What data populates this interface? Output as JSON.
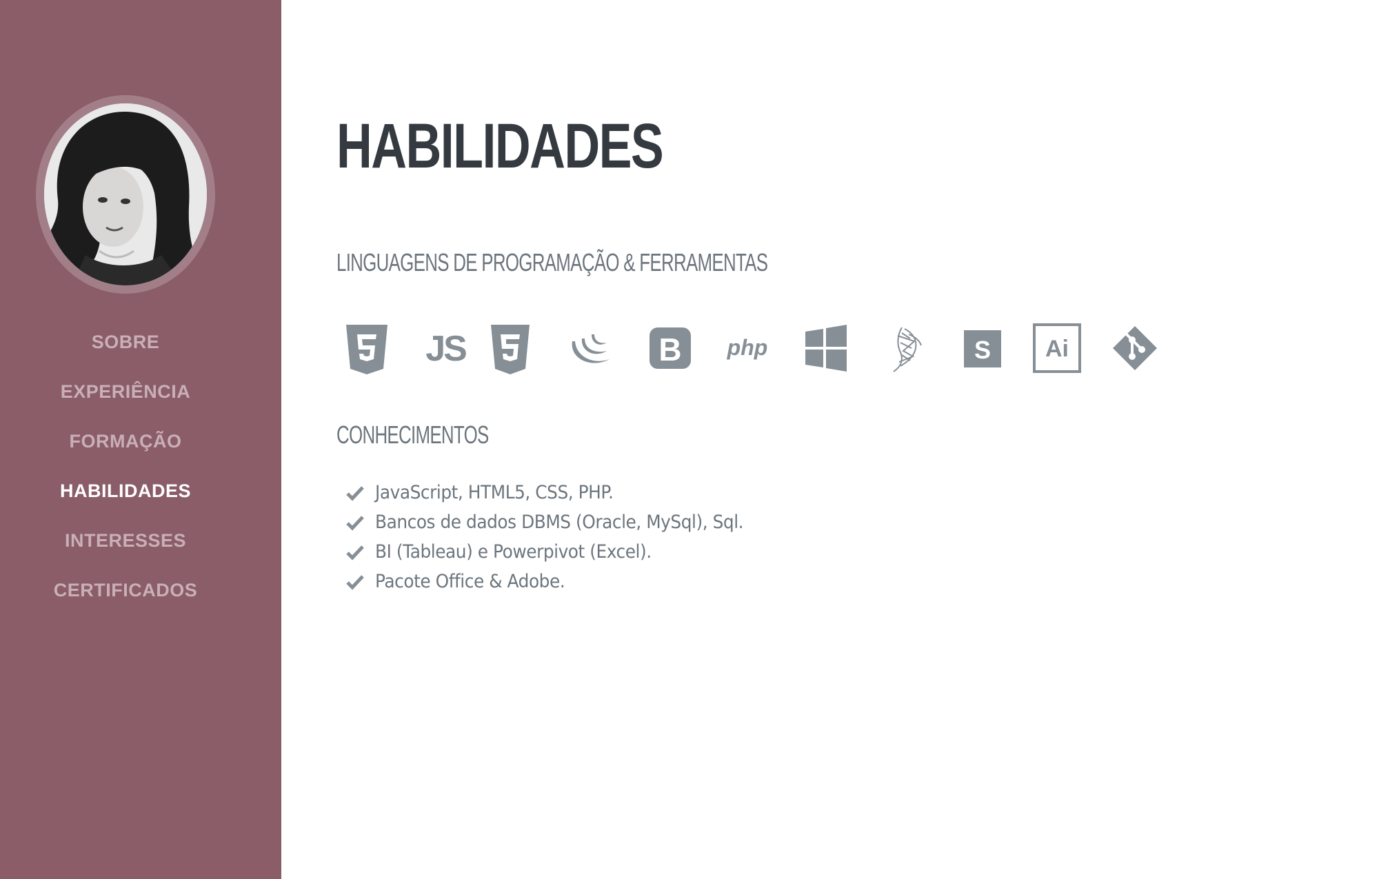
{
  "sidebar": {
    "avatar_alt": "Profile photo",
    "nav": [
      {
        "label": "SOBRE",
        "active": false
      },
      {
        "label": "EXPERIÊNCIA",
        "active": false
      },
      {
        "label": "FORMAÇÃO",
        "active": false
      },
      {
        "label": "HABILIDADES",
        "active": true
      },
      {
        "label": "INTERESSES",
        "active": false
      },
      {
        "label": "CERTIFICADOS",
        "active": false
      }
    ]
  },
  "main": {
    "title": "HABILIDADES",
    "tools_heading": "LINGUAGENS DE PROGRAMAÇÃO & FERRAMENTAS",
    "tools": [
      {
        "icon": "html5-icon",
        "text": ""
      },
      {
        "icon": "javascript-icon",
        "text": "JS"
      },
      {
        "icon": "css3-icon",
        "text": ""
      },
      {
        "icon": "jquery-icon",
        "text": ""
      },
      {
        "icon": "bootstrap-icon",
        "text": "B"
      },
      {
        "icon": "php-icon",
        "text": "php"
      },
      {
        "icon": "windows-icon",
        "text": ""
      },
      {
        "icon": "sql-server-icon",
        "text": ""
      },
      {
        "icon": "sass-icon",
        "text": "S"
      },
      {
        "icon": "illustrator-icon",
        "text": "Ai"
      },
      {
        "icon": "git-icon",
        "text": ""
      }
    ],
    "knowledge_heading": "CONHECIMENTOS",
    "knowledge": [
      "JavaScript, HTML5, CSS, PHP.",
      "Bancos de dados DBMS (Oracle, MySql), Sql.",
      "BI (Tableau) e Powerpivot (Excel).",
      "Pacote Office & Adobe."
    ]
  },
  "colors": {
    "sidebar": "#8a5d68",
    "nav_inactive": "#c9b0b6",
    "nav_active": "#ffffff",
    "title": "#343a40",
    "muted": "#6c757d",
    "icon": "#868e96"
  }
}
